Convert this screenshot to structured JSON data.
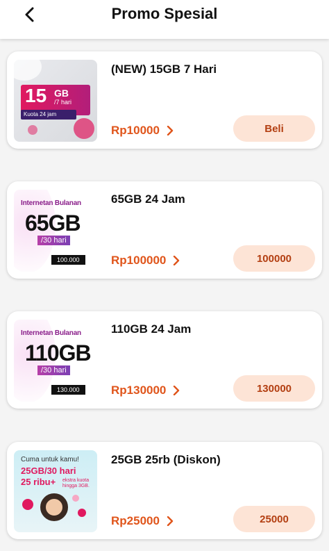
{
  "header": {
    "title": "Promo Spesial"
  },
  "products": [
    {
      "name": "(NEW) 15GB 7 Hari",
      "price": "Rp10000",
      "button": "Beli",
      "thumb": {
        "big": "15",
        "gb": "GB",
        "period": "/7 hari",
        "kuota": "Kuota 24 jam"
      }
    },
    {
      "name": "65GB 24 Jam",
      "price": "Rp100000",
      "button": "100000",
      "thumb": {
        "sub": "Internetan Bulanan",
        "big": "65GB",
        "period": "/30 hari",
        "price": "100.000"
      }
    },
    {
      "name": "110GB 24 Jam",
      "price": "Rp130000",
      "button": "130000",
      "thumb": {
        "sub": "Internetan Bulanan",
        "big": "110GB",
        "period": "/30 hari",
        "price": "130.000"
      }
    },
    {
      "name": "25GB 25rb (Diskon)",
      "price": "Rp25000",
      "button": "25000",
      "thumb": {
        "l1": "Cuma untuk kamu!",
        "l2": "25GB/30 hari",
        "l3": "25 ribu+",
        "l4": "ekstra kuota hingga 3GB."
      }
    }
  ],
  "colors": {
    "accent": "#e0551b",
    "button_bg": "#fde4d6",
    "button_text": "#b33f12"
  }
}
